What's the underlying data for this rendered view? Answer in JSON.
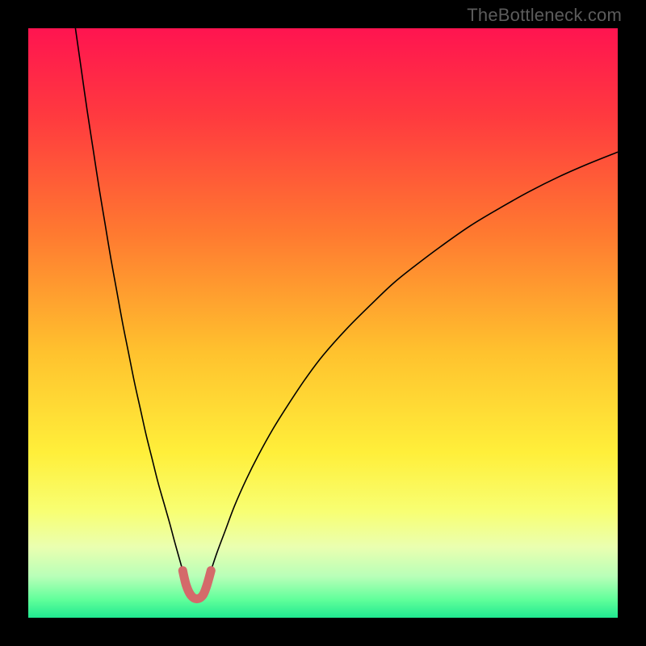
{
  "watermark": "TheBottleneck.com",
  "chart_data": {
    "type": "line",
    "title": "",
    "xlabel": "",
    "ylabel": "",
    "xlim": [
      0,
      100
    ],
    "ylim": [
      0,
      100
    ],
    "grid": false,
    "legend": false,
    "gradient_stops": [
      {
        "offset": 0.0,
        "color": "#ff1450"
      },
      {
        "offset": 0.15,
        "color": "#ff3a3f"
      },
      {
        "offset": 0.35,
        "color": "#ff7a30"
      },
      {
        "offset": 0.55,
        "color": "#ffc22e"
      },
      {
        "offset": 0.72,
        "color": "#ffef3a"
      },
      {
        "offset": 0.82,
        "color": "#f8ff73"
      },
      {
        "offset": 0.88,
        "color": "#eaffb0"
      },
      {
        "offset": 0.93,
        "color": "#b8ffb8"
      },
      {
        "offset": 0.97,
        "color": "#5fff9a"
      },
      {
        "offset": 1.0,
        "color": "#20e890"
      }
    ],
    "series": [
      {
        "name": "left-curve",
        "stroke": "#000000",
        "stroke_width": 1.6,
        "points": [
          {
            "x": 8.0,
            "y": 100.0
          },
          {
            "x": 9.0,
            "y": 93.0
          },
          {
            "x": 10.0,
            "y": 86.0
          },
          {
            "x": 11.0,
            "y": 79.5
          },
          {
            "x": 12.0,
            "y": 73.0
          },
          {
            "x": 13.0,
            "y": 67.0
          },
          {
            "x": 14.0,
            "y": 61.0
          },
          {
            "x": 15.0,
            "y": 55.5
          },
          {
            "x": 16.0,
            "y": 50.0
          },
          {
            "x": 17.0,
            "y": 45.0
          },
          {
            "x": 18.0,
            "y": 40.0
          },
          {
            "x": 19.0,
            "y": 35.5
          },
          {
            "x": 20.0,
            "y": 31.0
          },
          {
            "x": 21.0,
            "y": 27.0
          },
          {
            "x": 22.0,
            "y": 23.0
          },
          {
            "x": 23.0,
            "y": 19.5
          },
          {
            "x": 24.0,
            "y": 16.0
          },
          {
            "x": 24.8,
            "y": 13.0
          },
          {
            "x": 25.5,
            "y": 10.5
          },
          {
            "x": 26.2,
            "y": 8.0
          }
        ]
      },
      {
        "name": "right-curve",
        "stroke": "#000000",
        "stroke_width": 1.6,
        "points": [
          {
            "x": 31.0,
            "y": 8.0
          },
          {
            "x": 32.0,
            "y": 11.0
          },
          {
            "x": 33.5,
            "y": 15.0
          },
          {
            "x": 35.0,
            "y": 19.0
          },
          {
            "x": 37.0,
            "y": 23.5
          },
          {
            "x": 39.0,
            "y": 27.5
          },
          {
            "x": 41.5,
            "y": 32.0
          },
          {
            "x": 44.0,
            "y": 36.0
          },
          {
            "x": 47.0,
            "y": 40.5
          },
          {
            "x": 50.0,
            "y": 44.5
          },
          {
            "x": 54.0,
            "y": 49.0
          },
          {
            "x": 58.0,
            "y": 53.0
          },
          {
            "x": 62.0,
            "y": 56.8
          },
          {
            "x": 66.0,
            "y": 60.0
          },
          {
            "x": 70.0,
            "y": 63.0
          },
          {
            "x": 75.0,
            "y": 66.5
          },
          {
            "x": 80.0,
            "y": 69.5
          },
          {
            "x": 85.0,
            "y": 72.3
          },
          {
            "x": 90.0,
            "y": 74.8
          },
          {
            "x": 95.0,
            "y": 77.0
          },
          {
            "x": 100.0,
            "y": 79.0
          }
        ]
      },
      {
        "name": "dip-highlight",
        "stroke": "#d46a6a",
        "stroke_width": 11,
        "linecap": "round",
        "points": [
          {
            "x": 26.2,
            "y": 8.0
          },
          {
            "x": 26.8,
            "y": 5.5
          },
          {
            "x": 27.6,
            "y": 3.8
          },
          {
            "x": 28.6,
            "y": 3.2
          },
          {
            "x": 29.6,
            "y": 3.8
          },
          {
            "x": 30.3,
            "y": 5.5
          },
          {
            "x": 31.0,
            "y": 8.0
          }
        ]
      }
    ],
    "annotations": []
  }
}
